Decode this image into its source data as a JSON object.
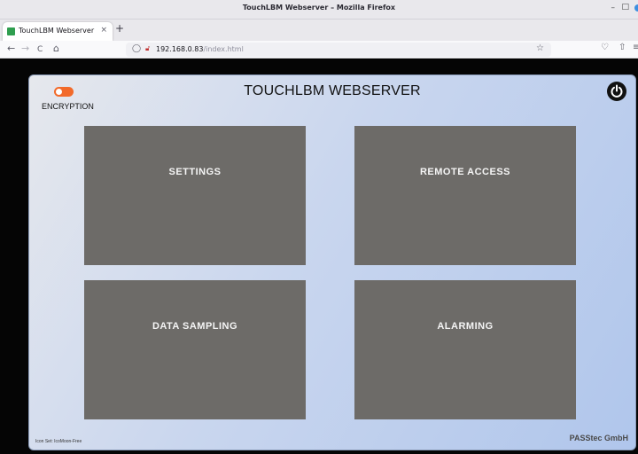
{
  "window": {
    "title": "TouchLBM Webserver – Mozilla Firefox",
    "minimize": "–",
    "maximize": "□"
  },
  "tab": {
    "title": "TouchLBM Webserver",
    "close": "×",
    "new_tab": "+"
  },
  "nav": {
    "back": "←",
    "forward": "→",
    "reload": "C",
    "home": "⌂",
    "url_host": "192.168.0.83",
    "url_path": "/index.html",
    "bookmark": "☆",
    "pocket": "♡",
    "extensions": "⇧",
    "menu": "≡"
  },
  "page": {
    "title": "TOUCHLBM WEBSERVER",
    "encryption_label": "ENCRYPTION",
    "encryption_on": true,
    "tiles": [
      "SETTINGS",
      "REMOTE ACCESS",
      "DATA SAMPLING",
      "ALARMING"
    ],
    "icon_credit": "Icon Set: IcoMoon-Free",
    "company": "PASStec GmbH"
  },
  "colors": {
    "tile": "#6d6b68",
    "toggle": "#f26a2a",
    "panel_gradient_start": "#e6e8ed",
    "panel_gradient_end": "#b0c6ec"
  }
}
